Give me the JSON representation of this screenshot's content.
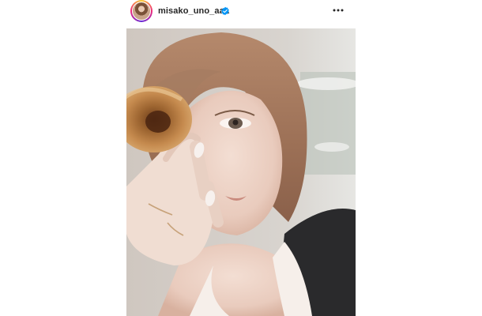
{
  "post": {
    "username": "misako_uno_aaa",
    "verified": true,
    "icons": {
      "avatar": "profile-avatar",
      "verified": "verified-badge-icon",
      "more": "more-options-icon"
    },
    "colors": {
      "verified_blue": "#0095f6",
      "username_text": "#262626"
    }
  }
}
